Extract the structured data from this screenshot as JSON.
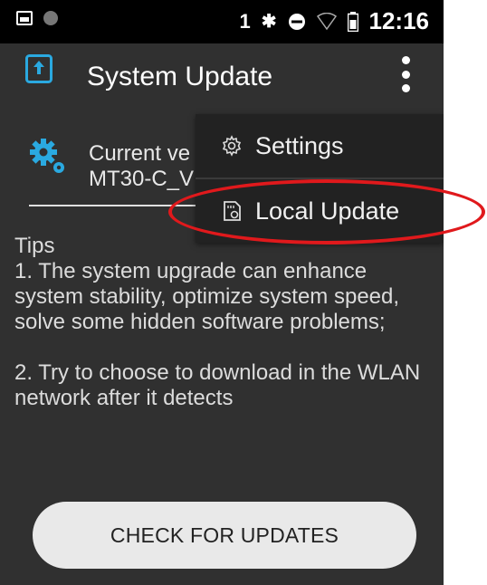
{
  "status_bar": {
    "sim_number": "1",
    "time": "12:16",
    "icons": [
      "image-notification-icon",
      "dot-notification-icon",
      "bluetooth-icon",
      "do-not-disturb-icon",
      "wifi-icon",
      "battery-icon"
    ]
  },
  "toolbar": {
    "title": "System Update",
    "app_icon": "system-update-icon",
    "overflow_icon": "more-vert-icon"
  },
  "version": {
    "title": "Current ve",
    "value": "MT30-C_V"
  },
  "tips": {
    "heading": "Tips",
    "item1": "1. The system upgrade can enhance system stability, optimize system speed, solve some hidden software problems;",
    "item2": " 2. Try to choose to download in the WLAN network after it detects"
  },
  "check_button": {
    "label": "CHECK FOR UPDATES"
  },
  "menu": {
    "items": [
      {
        "label": "Settings",
        "icon": "gear-outline-icon"
      },
      {
        "label": "Local Update",
        "icon": "sd-card-update-icon"
      }
    ]
  },
  "colors": {
    "background": "#303030",
    "accent": "#2aa9e0",
    "highlight": "#e0191c"
  }
}
